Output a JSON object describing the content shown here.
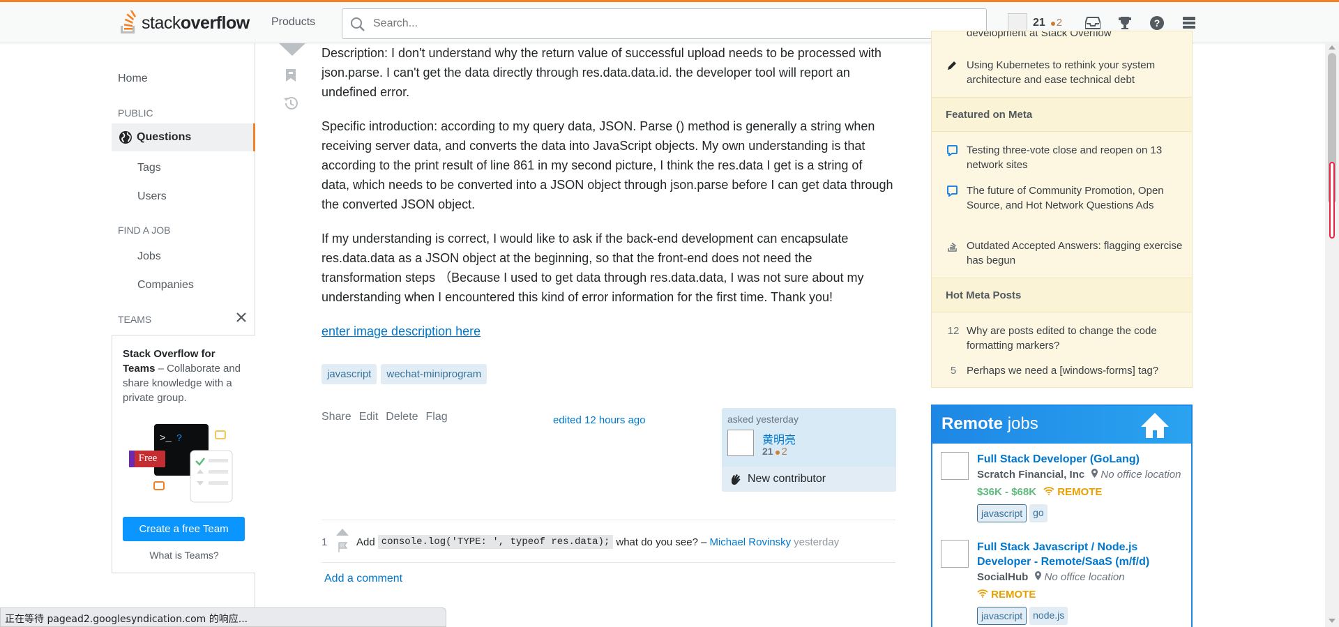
{
  "header": {
    "logo_text_light": "stack",
    "logo_text_bold": "overflow",
    "products_label": "Products",
    "search_placeholder": "Search...",
    "user_rep": "21",
    "user_bronze": "2"
  },
  "leftnav": {
    "home": "Home",
    "public_section": "PUBLIC",
    "questions": "Questions",
    "tags": "Tags",
    "users": "Users",
    "job_section": "FIND A JOB",
    "jobs": "Jobs",
    "companies": "Companies",
    "teams_section": "TEAMS",
    "teams_title": "Stack Overflow for Teams",
    "teams_desc": " – Collaborate and share knowledge with a private group.",
    "free_label": "Free",
    "create_team": "Create a free Team",
    "what_teams": "What is Teams?"
  },
  "post": {
    "p1": "Description: I don't understand why the return value of successful upload needs to be processed with json.parse. I can't get the data directly through res.data.data.id. the developer tool will report an undefined error.",
    "p2": "Specific introduction: according to my query data, JSON. Parse () method is generally a string when receiving server data, and converts the data into JavaScript objects. My own understanding is that according to the print result of line 861 in my second picture, I think the res.data I get is a string of data, which needs to be converted into a JSON object through json.parse before I can get data through the converted JSON object.",
    "p3": "If my understanding is correct, I would like to ask if the back-end development can encapsulate res.data.data as a JSON object at the beginning, so that the front-end does not need the transformation steps （Because I used to get data through res.data.data, I was not sure about my understanding when I encountered this kind of error information for the first time. Thank you!",
    "image_link": "enter image description here",
    "tags": [
      "javascript",
      "wechat-miniprogram"
    ],
    "menu": [
      "Share",
      "Edit",
      "Delete",
      "Flag"
    ],
    "edited": "edited 12 hours ago",
    "asked": "asked yesterday",
    "author": "黄明亮",
    "author_rep": "21",
    "author_bronze": "2",
    "new_contributor": "New contributor"
  },
  "comment": {
    "score": "1",
    "text_pre": "Add",
    "code": "console.log('TYPE: ', typeof res.data);",
    "text_post": "what do you see? –",
    "user": "Michael Rovinsky",
    "time": "yesterday",
    "add_comment": "Add a comment"
  },
  "sidebar": {
    "blog_partial": "development at Stack Overflow",
    "blog_item": "Using Kubernetes to rethink your system architecture and ease technical debt",
    "featured_header": "Featured on Meta",
    "featured": [
      "Testing three-vote close and reopen on 13 network sites",
      "The future of Community Promotion, Open Source, and Hot Network Questions Ads",
      "Outdated Accepted Answers: flagging exercise has begun"
    ],
    "hot_header": "Hot Meta Posts",
    "hot": [
      {
        "num": "12",
        "title": "Why are posts edited to change the code formatting markers?"
      },
      {
        "num": "5",
        "title": "Perhaps we need a [windows-forms] tag?"
      }
    ]
  },
  "jobs": {
    "head_bold": "Remote",
    "head_rest": " jobs",
    "list": [
      {
        "title": "Full Stack Developer (GoLang)",
        "company": "Scratch Financial, Inc",
        "location": "No office location",
        "salary": "$36K - $68K",
        "remote": "REMOTE",
        "tags": [
          "javascript",
          "go"
        ]
      },
      {
        "title": "Full Stack Javascript / Node.js Developer - Remote/SaaS (m/f/d)",
        "company": "SocialHub",
        "location": "No office location",
        "salary": "",
        "remote": "REMOTE",
        "tags": [
          "javascript",
          "node.js"
        ]
      }
    ]
  },
  "statusbar": "正在等待 pagead2.googlesyndication.com 的响应...",
  "colors": {
    "accent": "#f48024",
    "link": "#0077cc",
    "tag_bg": "#e1ecf4",
    "tag_fg": "#39739d",
    "primary_button": "#0a95ff"
  }
}
